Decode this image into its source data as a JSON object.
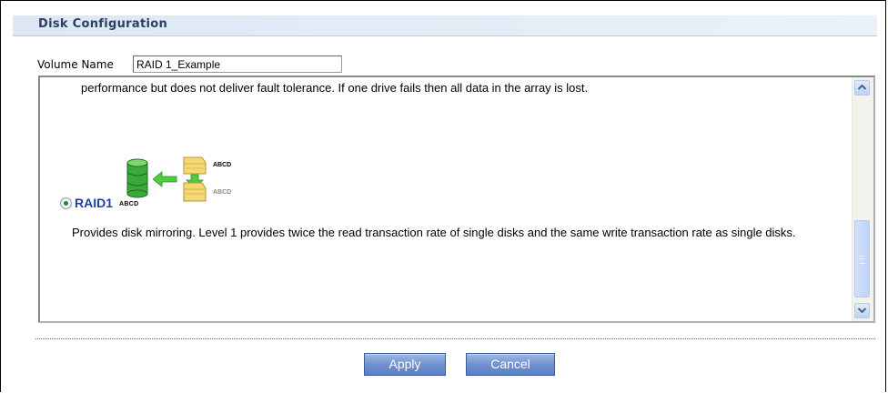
{
  "section": {
    "title": "Disk Configuration"
  },
  "volume": {
    "label": "Volume Name",
    "value": "RAID 1_Example"
  },
  "panel": {
    "performance_text": "performance but does not deliver fault tolerance. If one drive fails then all data in the array is lost.",
    "raid1": {
      "label": "RAID1",
      "icon_caption_primary": "ABCD",
      "icon_caption_source": "ABCD",
      "icon_caption_mirror": "ABCD",
      "selected": true,
      "description": "Provides disk mirroring. Level 1 provides twice the read transaction rate of single disks and the same write transaction rate as single disks."
    }
  },
  "buttons": {
    "apply": "Apply",
    "cancel": "Cancel"
  },
  "colors": {
    "title_text": "#2b3f63",
    "raid_label": "#1f3fa8",
    "button_blue": "#6d8fd0"
  }
}
